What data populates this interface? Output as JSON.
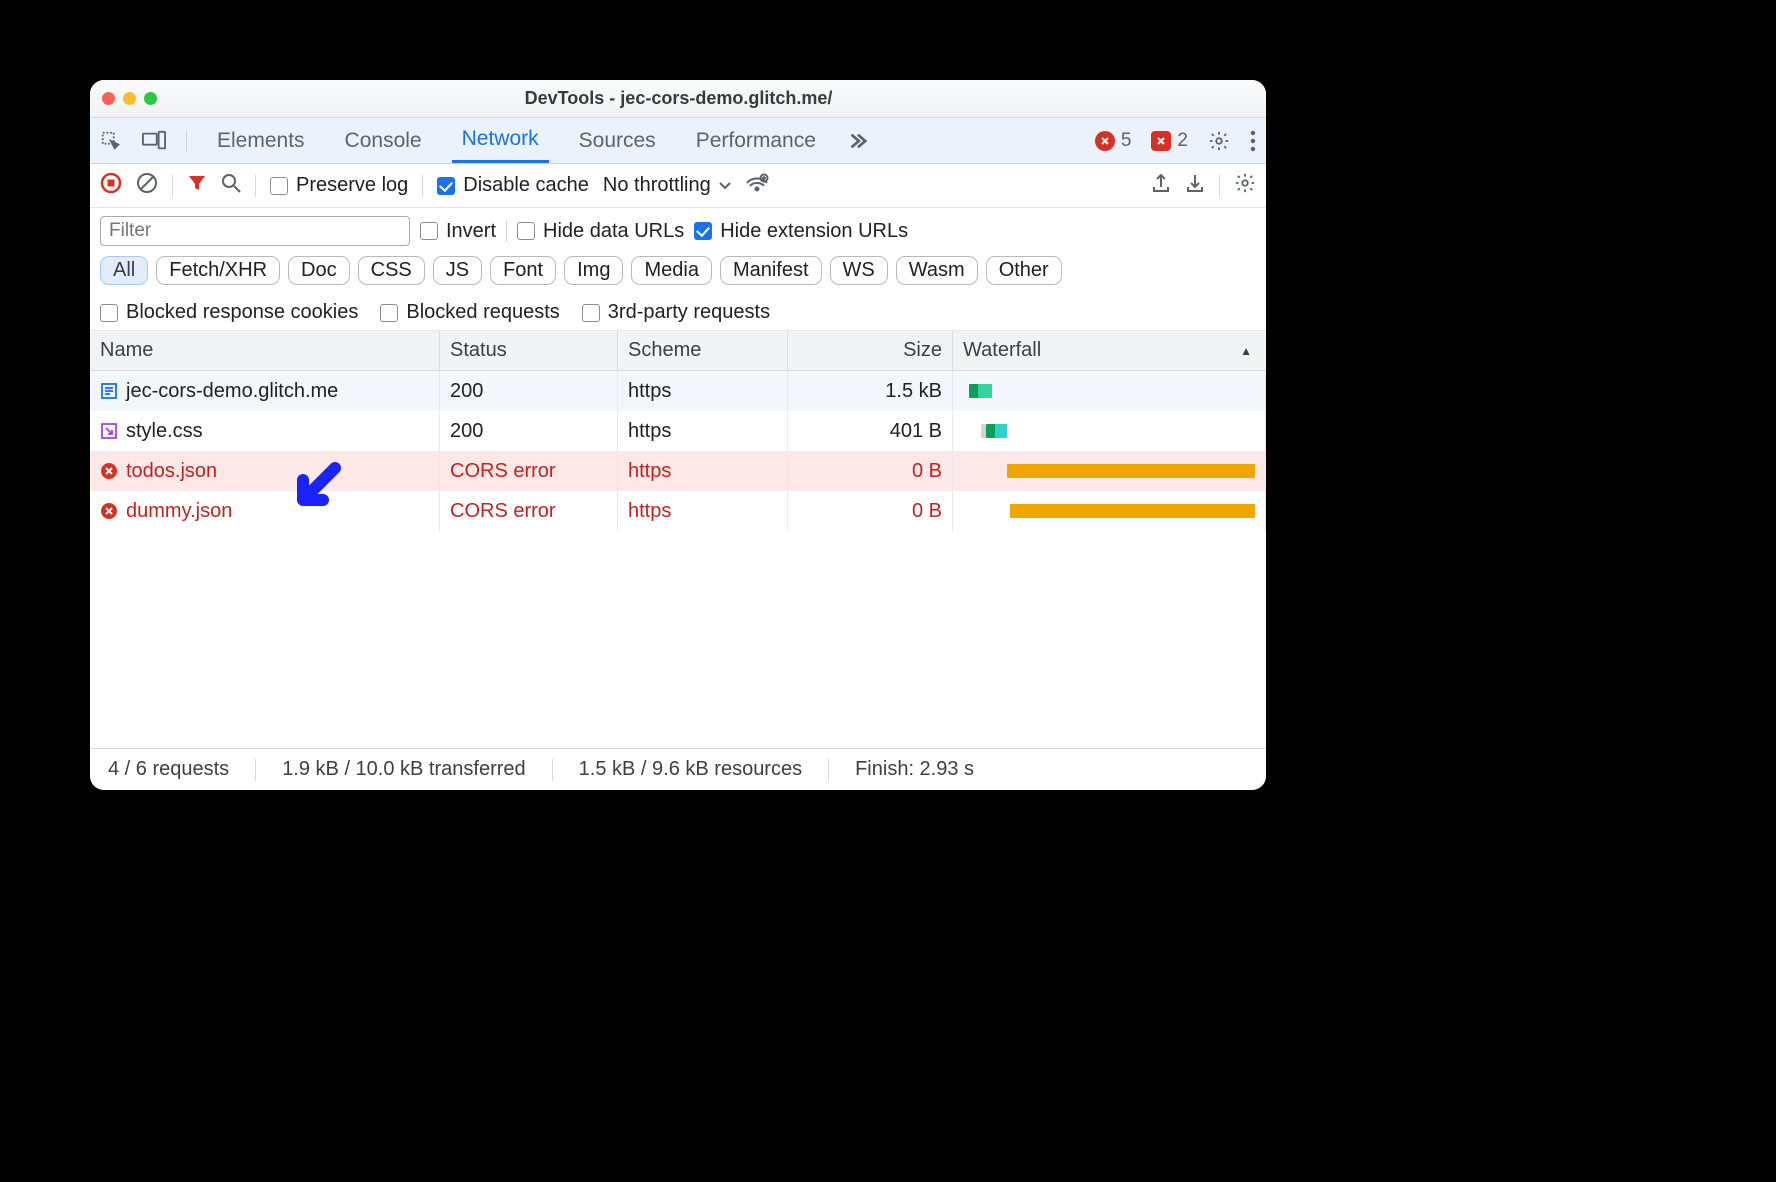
{
  "window": {
    "title": "DevTools - jec-cors-demo.glitch.me/"
  },
  "tabs": {
    "elements": "Elements",
    "console": "Console",
    "network": "Network",
    "sources": "Sources",
    "performance": "Performance"
  },
  "badges": {
    "errors": "5",
    "issues": "2"
  },
  "toolbar": {
    "preserve_log": "Preserve log",
    "disable_cache": "Disable cache",
    "throttling": "No throttling"
  },
  "filters": {
    "placeholder": "Filter",
    "invert": "Invert",
    "hide_data_urls": "Hide data URLs",
    "hide_ext_urls": "Hide extension URLs",
    "types": [
      "All",
      "Fetch/XHR",
      "Doc",
      "CSS",
      "JS",
      "Font",
      "Img",
      "Media",
      "Manifest",
      "WS",
      "Wasm",
      "Other"
    ],
    "blocked_cookies": "Blocked response cookies",
    "blocked_requests": "Blocked requests",
    "third_party": "3rd-party requests"
  },
  "columns": {
    "name": "Name",
    "status": "Status",
    "scheme": "Scheme",
    "size": "Size",
    "waterfall": "Waterfall"
  },
  "rows": [
    {
      "icon": "doc",
      "name": "jec-cors-demo.glitch.me",
      "status": "200",
      "scheme": "https",
      "size": "1.5 kB",
      "error": false
    },
    {
      "icon": "css",
      "name": "style.css",
      "status": "200",
      "scheme": "https",
      "size": "401 B",
      "error": false
    },
    {
      "icon": "err",
      "name": "todos.json",
      "status": "CORS error",
      "scheme": "https",
      "size": "0 B",
      "error": true,
      "highlight": true
    },
    {
      "icon": "err",
      "name": "dummy.json",
      "status": "CORS error",
      "scheme": "https",
      "size": "0 B",
      "error": true
    }
  ],
  "status": {
    "requests": "4 / 6 requests",
    "transferred": "1.9 kB / 10.0 kB transferred",
    "resources": "1.5 kB / 9.6 kB resources",
    "finish": "Finish: 2.93 s"
  }
}
